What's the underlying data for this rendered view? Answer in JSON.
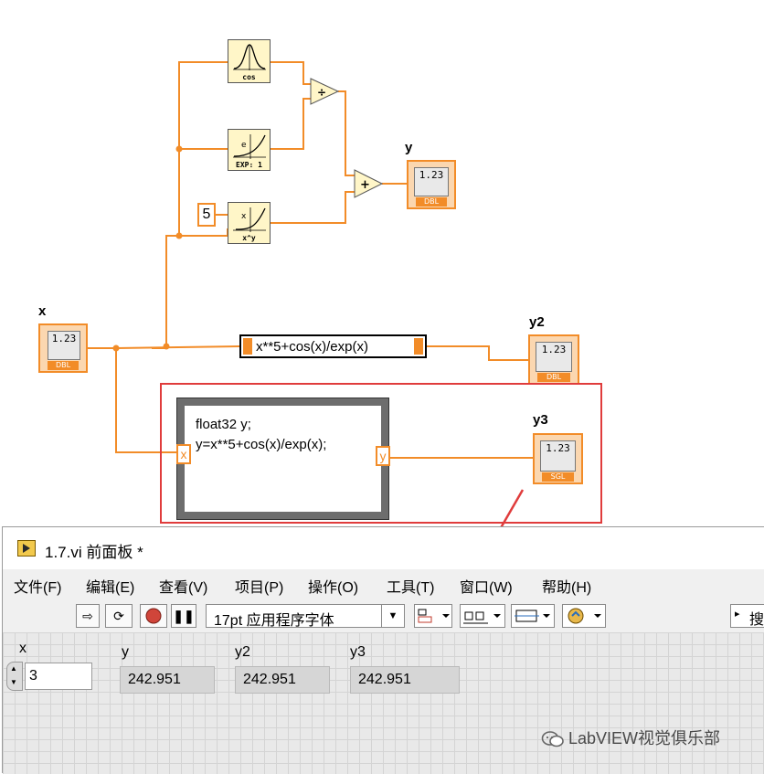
{
  "diagram": {
    "labels": {
      "y": "y",
      "x": "x",
      "y2": "y2",
      "y3": "y3"
    },
    "functions": {
      "cos_sub": "cos",
      "exp_sub": "EXP: 1",
      "pow_sub": "x^y"
    },
    "constant_five": "5",
    "indicator_value": "1.23",
    "indicator_tags": {
      "x": "DBL",
      "y": "DBL",
      "y2": "DBL",
      "y3": "SGL"
    },
    "expression": "x**5+cos(x)/exp(x)",
    "formula_code": "float32 y;\ny=x**5+cos(x)/exp(x);",
    "formula_in": "x",
    "formula_out": "y",
    "wire_color": "#f28c28",
    "highlight_color": "#e03c3c"
  },
  "window": {
    "title": "1.7.vi 前面板 *",
    "menu": [
      "文件(F)",
      "编辑(E)",
      "查看(V)",
      "项目(P)",
      "操作(O)",
      "工具(T)",
      "窗口(W)",
      "帮助(H)"
    ],
    "toolbar": {
      "font": "17pt 应用程序字体",
      "search_hint": "搜"
    },
    "panel": {
      "x": {
        "label": "x",
        "value": "3"
      },
      "y": {
        "label": "y",
        "value": "242.951"
      },
      "y2": {
        "label": "y2",
        "value": "242.951"
      },
      "y3": {
        "label": "y3",
        "value": "242.951"
      }
    }
  },
  "watermark": "LabVIEW视觉俱乐部"
}
